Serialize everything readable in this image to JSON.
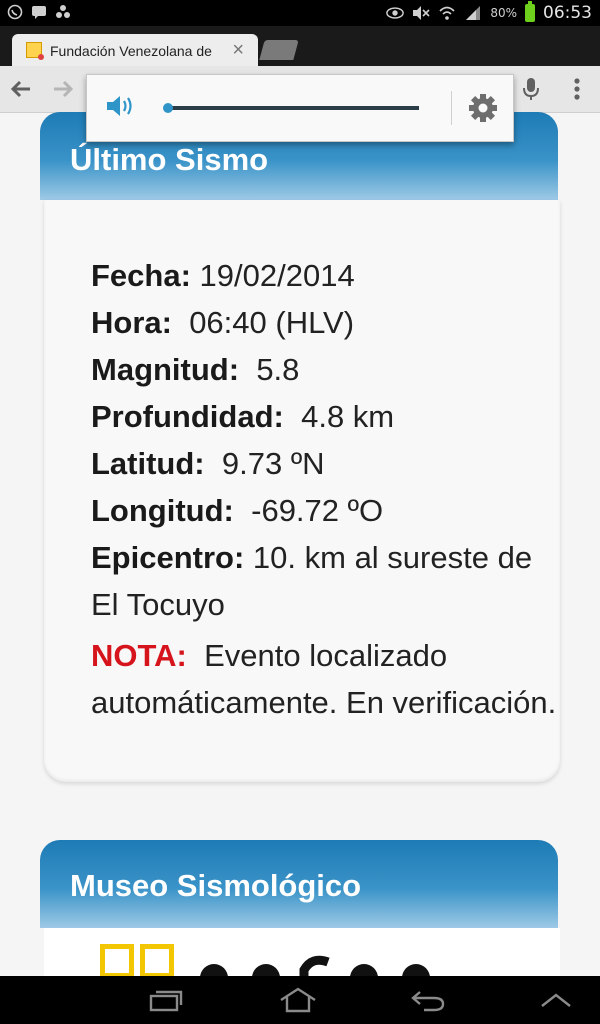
{
  "status_bar": {
    "battery": "80%",
    "time": "06:53",
    "icons": [
      "whatsapp-icon",
      "bbm-icon",
      "app-icon",
      "eye-icon",
      "mute-icon",
      "wifi-icon",
      "signal-icon",
      "battery-icon"
    ]
  },
  "browser": {
    "tab_title": "Fundación Venezolana de",
    "toolbar_icons": [
      "back-arrow-icon",
      "forward-arrow-icon",
      "microphone-icon",
      "overflow-menu-icon"
    ]
  },
  "volume_popup": {
    "level": 0.0,
    "accent_color": "#2f95c8",
    "icons": [
      "speaker-icon",
      "gear-icon"
    ]
  },
  "card1": {
    "title": "Último Sismo",
    "fecha_label": "Fecha:",
    "fecha_value": "19/02/2014",
    "hora_label": "Hora:",
    "hora_value": "06:40 (HLV)",
    "magnitud_label": "Magnitud:",
    "magnitud_value": "5.8",
    "profundidad_label": "Profundidad:",
    "profundidad_value": "4.8 km",
    "latitud_label": "Latitud:",
    "latitud_value": "9.73 ºN",
    "longitud_label": "Longitud:",
    "longitud_value": "-69.72 ºO",
    "epicentro_label": "Epicentro:",
    "epicentro_value": "10. km al sureste de El Tocuyo",
    "nota_label": "NOTA:",
    "nota_text": "Evento localizado automáticamente. En verificación."
  },
  "card2": {
    "title": "Museo Sismológico"
  },
  "header_color": "#1e7bb5",
  "nota_color": "#d6141c"
}
